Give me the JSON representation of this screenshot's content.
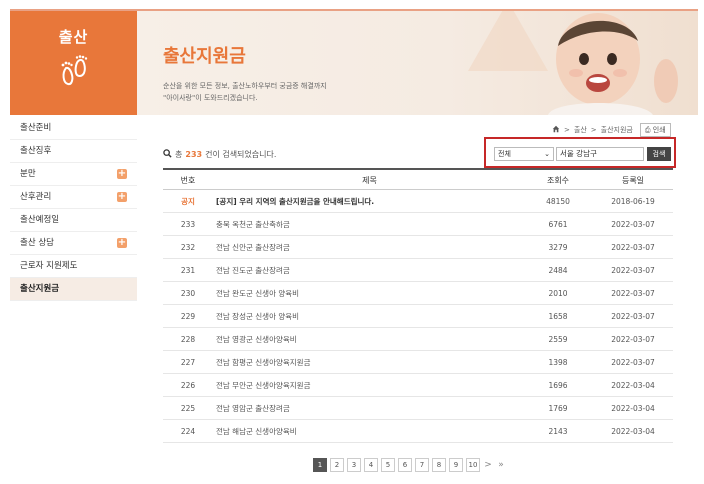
{
  "sidebar": {
    "title": "출산",
    "items": [
      {
        "label": "출산준비",
        "has_plus": false,
        "active": false
      },
      {
        "label": "출산징후",
        "has_plus": false,
        "active": false
      },
      {
        "label": "분만",
        "has_plus": true,
        "active": false
      },
      {
        "label": "산후관리",
        "has_plus": true,
        "active": false
      },
      {
        "label": "출산예정일",
        "has_plus": false,
        "active": false
      },
      {
        "label": "출산 상담",
        "has_plus": true,
        "active": false
      },
      {
        "label": "근로자 지원제도",
        "has_plus": false,
        "active": false
      },
      {
        "label": "출산지원금",
        "has_plus": false,
        "active": true
      }
    ]
  },
  "banner": {
    "title": "출산지원금",
    "desc_line1": "순산을 위한 모든 정보, 출산노하우부터 궁금증 해결까지",
    "desc_line2": "\"아이사랑\"이 도와드리겠습니다."
  },
  "breadcrumb": {
    "items": [
      "출산",
      "출산지원금"
    ],
    "print_label": "인쇄"
  },
  "search": {
    "count_prefix": "총",
    "count": "233",
    "count_suffix": "건이 검색되었습니다.",
    "select_value": "전체",
    "input_value": "서울 강남구",
    "button_label": "검색"
  },
  "table": {
    "headers": {
      "no": "번호",
      "title": "제목",
      "views": "조회수",
      "date": "등록일"
    },
    "rows": [
      {
        "no": "공지",
        "title": "[공지] 우리 지역의 출산지원금을 안내해드립니다.",
        "views": "48150",
        "date": "2018-06-19"
      },
      {
        "no": "233",
        "title": "충북 옥천군 출산축하금",
        "views": "6761",
        "date": "2022-03-07"
      },
      {
        "no": "232",
        "title": "전남 신안군 출산장려금",
        "views": "3279",
        "date": "2022-03-07"
      },
      {
        "no": "231",
        "title": "전남 진도군 출산장려금",
        "views": "2484",
        "date": "2022-03-07"
      },
      {
        "no": "230",
        "title": "전남 완도군 신생아 양육비",
        "views": "2010",
        "date": "2022-03-07"
      },
      {
        "no": "229",
        "title": "전남 장성군 신생아 양육비",
        "views": "1658",
        "date": "2022-03-07"
      },
      {
        "no": "228",
        "title": "전남 영광군 신생아양육비",
        "views": "2559",
        "date": "2022-03-07"
      },
      {
        "no": "227",
        "title": "전남 함평군 신생아양육지원금",
        "views": "1398",
        "date": "2022-03-07"
      },
      {
        "no": "226",
        "title": "전남 무안군 신생아양육지원금",
        "views": "1696",
        "date": "2022-03-04"
      },
      {
        "no": "225",
        "title": "전남 영암군 출산장려금",
        "views": "1769",
        "date": "2022-03-04"
      },
      {
        "no": "224",
        "title": "전남 해남군 신생아양육비",
        "views": "2143",
        "date": "2022-03-04"
      }
    ]
  },
  "pagination": {
    "pages": [
      "1",
      "2",
      "3",
      "4",
      "5",
      "6",
      "7",
      "8",
      "9",
      "10"
    ],
    "current": "1",
    "next": ">",
    "last": "»"
  }
}
